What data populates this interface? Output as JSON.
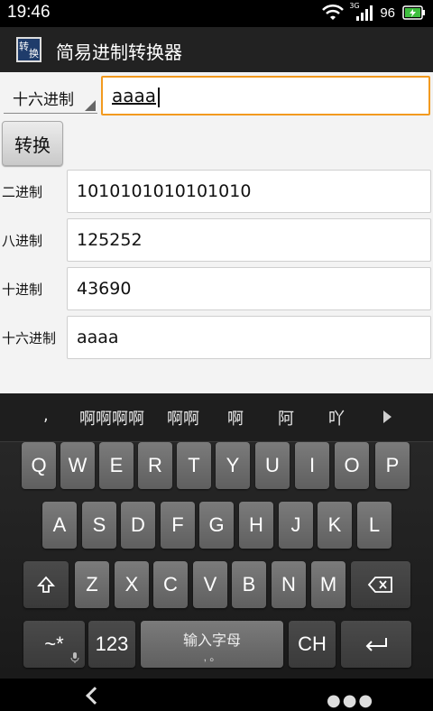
{
  "status": {
    "time": "19:46",
    "network": "3G",
    "battery": "96"
  },
  "app": {
    "icon_chars": [
      "转",
      "换"
    ],
    "title": "简易进制转换器"
  },
  "input": {
    "base_selected": "十六进制",
    "value": "aaaa",
    "convert_label": "转换"
  },
  "results": [
    {
      "label": "二进制",
      "value": "1010101010101010"
    },
    {
      "label": "八进制",
      "value": "125252"
    },
    {
      "label": "十进制",
      "value": "43690"
    },
    {
      "label": "十六进制",
      "value": "aaaa"
    }
  ],
  "keyboard": {
    "candidates": [
      ",",
      "啊啊啊啊",
      "啊啊",
      "啊",
      "阿",
      "吖"
    ],
    "row1": [
      "Q",
      "W",
      "E",
      "R",
      "T",
      "Y",
      "U",
      "I",
      "O",
      "P"
    ],
    "row2": [
      "A",
      "S",
      "D",
      "F",
      "G",
      "H",
      "J",
      "K",
      "L"
    ],
    "row3": [
      "Z",
      "X",
      "C",
      "V",
      "B",
      "N",
      "M"
    ],
    "symbols_label": "~*",
    "numbers_label": "123",
    "space_label": "输入字母",
    "space_sub": ", 。",
    "lang_label": "CH"
  },
  "colors": {
    "accent": "#f29a1f",
    "actionbar": "#222222",
    "content_bg": "#f3f3f3"
  }
}
